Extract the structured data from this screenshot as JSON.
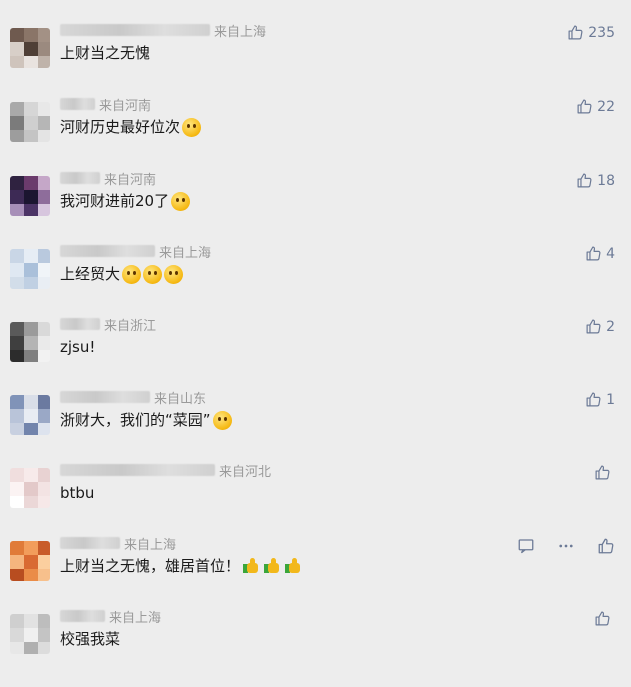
{
  "comments": [
    {
      "region": "来自上海",
      "text": "上财当之无愧",
      "emoji": "",
      "likes": "235",
      "avatar": [
        "#6f5a4f",
        "#8a7568",
        "#a39185",
        "#d8cfc8",
        "#4f3f36",
        "#9b8a7f",
        "#cfc4bc",
        "#e9e3df",
        "#bfb3aa"
      ]
    },
    {
      "region": "来自河南",
      "text": "河财历史最好位次",
      "emoji": "smile",
      "likes": "22",
      "avatar": [
        "#a9a9a9",
        "#d6d6d6",
        "#e8e8e8",
        "#7b7b7b",
        "#cfcfcf",
        "#b6b6b6",
        "#9d9d9d",
        "#c4c4c4",
        "#e4e4e4"
      ]
    },
    {
      "region": "来自河南",
      "text": "我河财进前20了",
      "emoji": "cry",
      "likes": "18",
      "avatar": [
        "#2f2240",
        "#6b3b6c",
        "#c5a7c8",
        "#3d2a55",
        "#1b1530",
        "#8e6d9b",
        "#a78fb8",
        "#4c3466",
        "#d7c6de"
      ]
    },
    {
      "region": "来自上海",
      "text": "上经贸大",
      "emoji": "pleading3",
      "likes": "4",
      "avatar": [
        "#c9d6e6",
        "#e6edf5",
        "#b9c9de",
        "#dfe8f2",
        "#aac0da",
        "#f0f4f8",
        "#d2dde9",
        "#c0d0e3",
        "#e9eef4"
      ]
    },
    {
      "region": "来自浙江",
      "text": "zjsu!",
      "emoji": "",
      "likes": "2",
      "avatar": [
        "#5a5a5a",
        "#9b9b9b",
        "#d9d9d9",
        "#3f3f3f",
        "#b4b4b4",
        "#eaeaea",
        "#2c2c2c",
        "#808080",
        "#f2f2f2"
      ]
    },
    {
      "region": "来自山东",
      "text": "浙财大，我们的“菜园”",
      "emoji": "grin",
      "likes": "1",
      "avatar": [
        "#8093b8",
        "#d9dee8",
        "#6b7aa0",
        "#b9c4d9",
        "#e8ecf3",
        "#9aa8c6",
        "#c8d0e0",
        "#7284ac",
        "#dde3ee"
      ]
    },
    {
      "region": "来自河北",
      "text": "btbu",
      "emoji": "",
      "likes": "",
      "avatar": [
        "#f0dede",
        "#f7eaea",
        "#e8d2d2",
        "#fbf3f3",
        "#e3c9c9",
        "#f3e3e3",
        "#ffffff",
        "#ebd7d7",
        "#f6e8e8"
      ]
    },
    {
      "region": "来自上海",
      "text": "上财当之无愧，雄居首位！",
      "emoji": "thumbs3",
      "likes": "",
      "avatar": [
        "#e07b39",
        "#f29d5b",
        "#c85c2a",
        "#f5b57e",
        "#d96a32",
        "#fbcf9f",
        "#b84d20",
        "#ea8c48",
        "#f7c08c"
      ]
    },
    {
      "region": "来自上海",
      "text": "校强我菜",
      "emoji": "",
      "likes": "",
      "avatar": [
        "#cfcfcf",
        "#e2e2e2",
        "#bdbdbd",
        "#d9d9d9",
        "#f0f0f0",
        "#c4c4c4",
        "#e7e7e7",
        "#b0b0b0",
        "#dcdcdc"
      ]
    }
  ],
  "blur_widths": [
    150,
    35,
    40,
    95,
    40,
    90,
    155,
    60,
    45
  ]
}
